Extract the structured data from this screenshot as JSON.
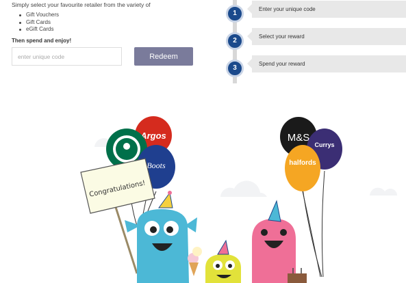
{
  "intro": "Simply select your favourite retailer from the variety of",
  "options": [
    "Gift Vouchers",
    "Gift Cards",
    "eGift Cards"
  ],
  "spend_heading": "Then spend and enjoy!",
  "code_input": {
    "placeholder": "enter unique code",
    "value": ""
  },
  "redeem_label": "Redeem",
  "steps": [
    {
      "number": "1",
      "label": "Enter your unique code"
    },
    {
      "number": "2",
      "label": "Select your reward"
    },
    {
      "number": "3",
      "label": "Spend your reward"
    }
  ],
  "illustration": {
    "banner": "Congratulations!",
    "balloons": [
      "Argos",
      "Boots",
      "M&S",
      "Currys",
      "halfords"
    ],
    "colors": {
      "argos": "#d52b1e",
      "starbucks": "#00704a",
      "boots": "#1f3f8f",
      "ms": "#1a1a1a",
      "currys": "#3b2e74",
      "halfords": "#f5a623",
      "blue_monster": "#4cb8d6",
      "pink_monster": "#ef6f97",
      "yellow_monster": "#e2e23a"
    }
  }
}
